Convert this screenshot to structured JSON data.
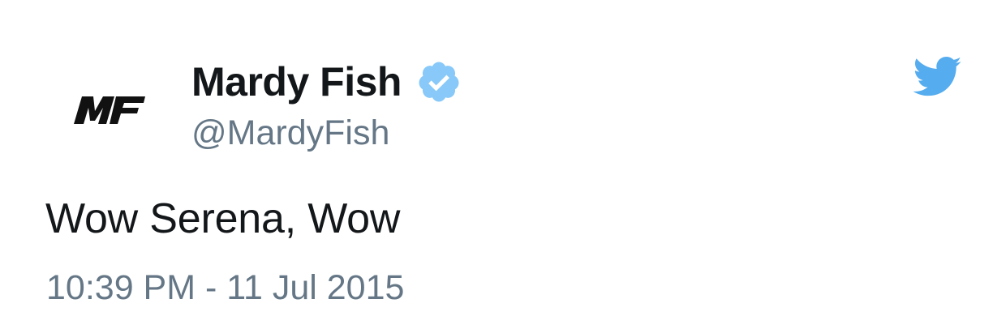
{
  "tweet": {
    "author": {
      "display_name": "Mardy Fish",
      "handle": "@MardyFish",
      "verified": true,
      "avatar_text": "MF"
    },
    "text": "Wow Serena, Wow",
    "timestamp": "10:39 PM - 11 Jul 2015"
  },
  "icons": {
    "verified": "verified-badge-icon",
    "brand": "twitter-bird-icon"
  },
  "colors": {
    "brand_blue": "#55acee",
    "verified_blue": "#88c9f9",
    "text_primary": "#14171a",
    "text_secondary": "#657786"
  }
}
